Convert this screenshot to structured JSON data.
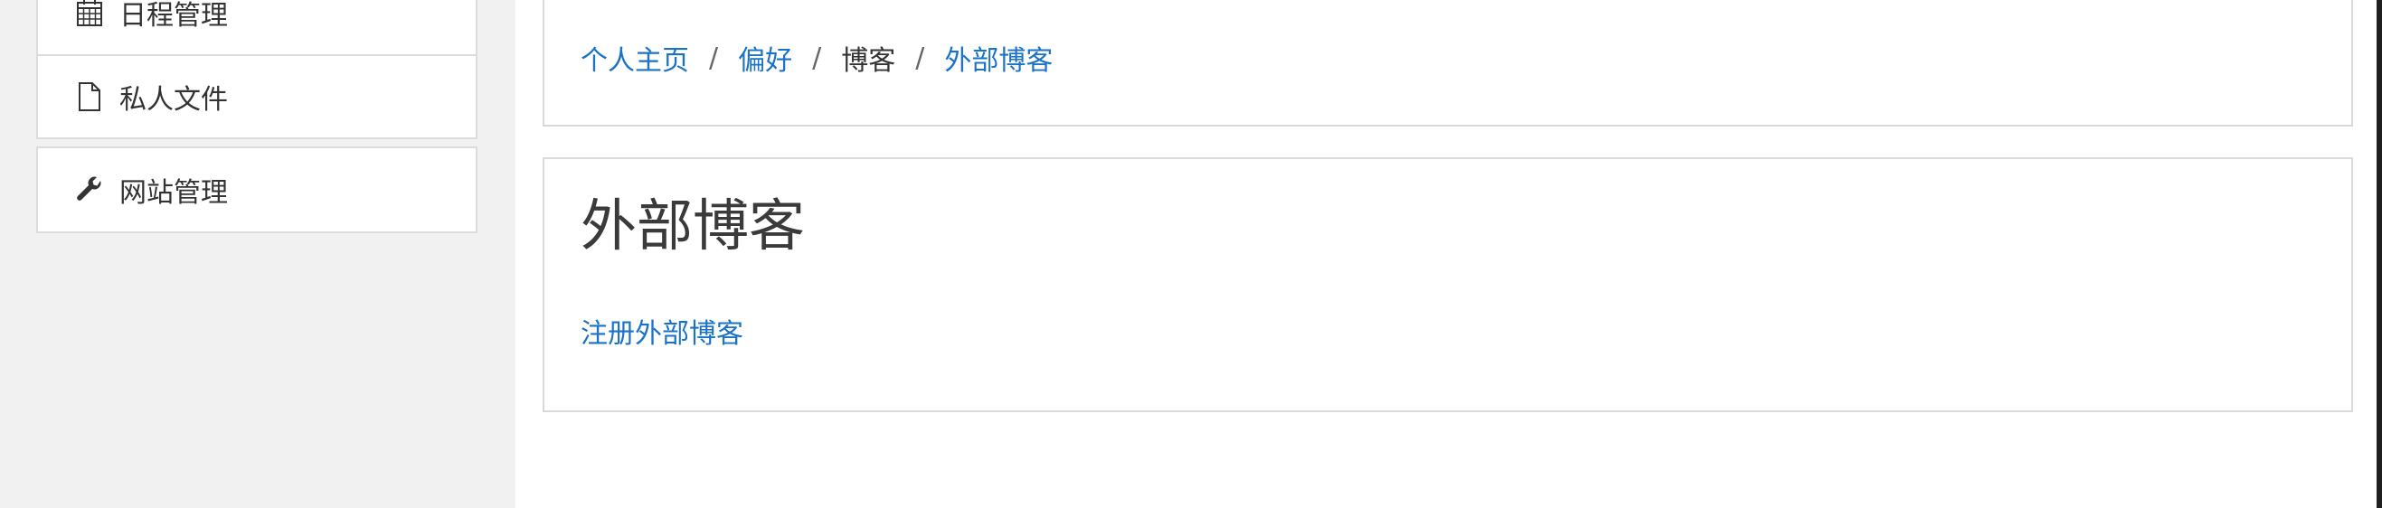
{
  "sidebar": {
    "items": [
      {
        "label": "日程管理",
        "icon": "calendar-icon"
      },
      {
        "label": "私人文件",
        "icon": "file-icon"
      }
    ],
    "admin": {
      "label": "网站管理",
      "icon": "wrench-icon"
    }
  },
  "breadcrumb": {
    "items": [
      {
        "label": "个人主页",
        "link": true
      },
      {
        "label": "偏好",
        "link": true
      },
      {
        "label": "博客",
        "link": false
      },
      {
        "label": "外部博客",
        "link": true
      }
    ],
    "separator": "/"
  },
  "main": {
    "heading": "外部博客",
    "register_link": "注册外部博客"
  },
  "colors": {
    "link": "#1a73c7",
    "sidebar_background": "#f1f1f1",
    "border": "#dcdcdc"
  }
}
